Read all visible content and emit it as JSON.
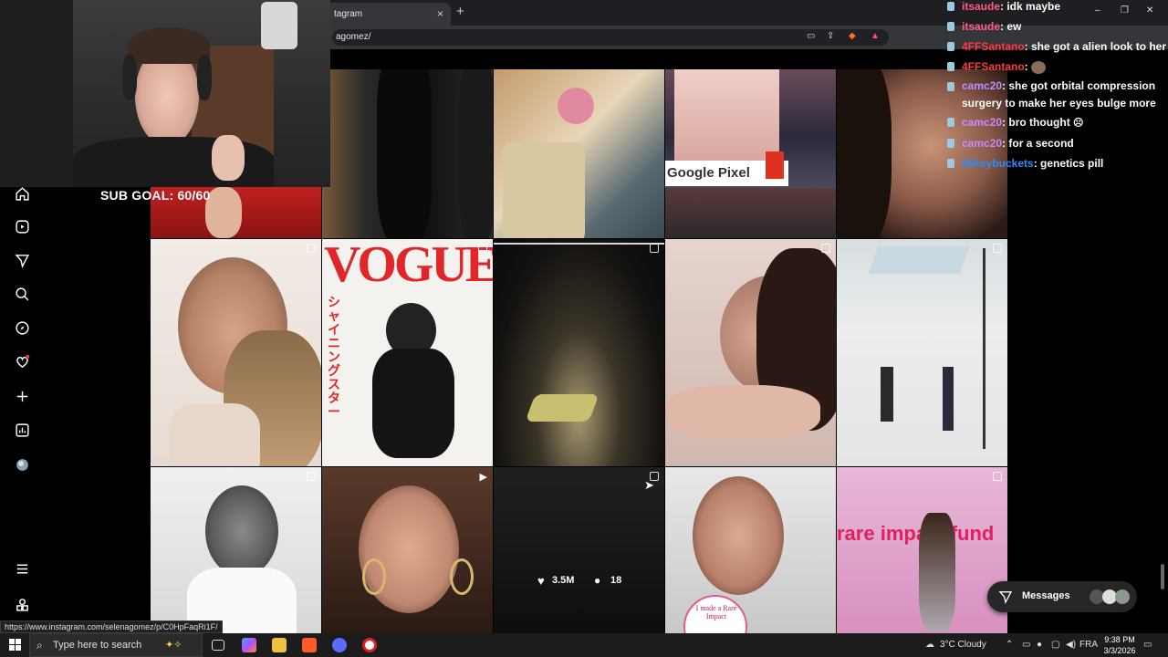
{
  "browser": {
    "tab_title": "tagram",
    "tab_close": "×",
    "new_tab": "+",
    "url": "agomez/",
    "window_controls": [
      "–",
      "❐",
      "✕"
    ]
  },
  "stream": {
    "sub_goal": "SUB GOAL: 60/60"
  },
  "chat": {
    "messages": [
      {
        "user": "itsaude",
        "text": ": idk maybe",
        "color": "#ff5a8a"
      },
      {
        "user": "itsaude",
        "text": ": ew",
        "color": "#ff5a8a"
      },
      {
        "user": "4FFSantano",
        "text": ": she got a alien look to her",
        "color": "#ff3a3a"
      },
      {
        "user": "4FFSantano",
        "text": ":",
        "color": "#ff3a3a"
      },
      {
        "user": "camc20",
        "text": ": she got orbital compression surgery to make her eyes bulge more",
        "color": "#c28bff"
      },
      {
        "user": "camc20",
        "text": ": bro thought",
        "color": "#c28bff"
      },
      {
        "user": "camc20",
        "text": ": for a second",
        "color": "#c28bff"
      },
      {
        "user": "Mikeybuckets",
        "text": ": genetics pill",
        "color": "#2e8bff"
      }
    ]
  },
  "instagram": {
    "nav_icons": [
      "home-icon",
      "reels-icon",
      "messages-icon",
      "search-icon",
      "explore-icon",
      "notifications-icon",
      "create-icon",
      "dashboard-icon",
      "profile-icon",
      "more-icon",
      "threads-icon"
    ],
    "hover_likes": "3.5M",
    "hover_comments": "18",
    "messages_label": "Messages",
    "vogue_text": "VOGUE",
    "vogue_sub": "シャイニングスター",
    "billboard_text": "Google Pixel",
    "event_text": "rare impact fund",
    "rare_impact_badge": "I made a Rare Impact"
  },
  "status_url": "https://www.instagram.com/selenagomez/p/C0HpFaqRi1F/",
  "taskbar": {
    "search_placeholder": "Type here to search",
    "weather": "3°C  Cloudy",
    "lang": "FRA",
    "time": "9:38 PM",
    "date": "3/3/2026"
  }
}
